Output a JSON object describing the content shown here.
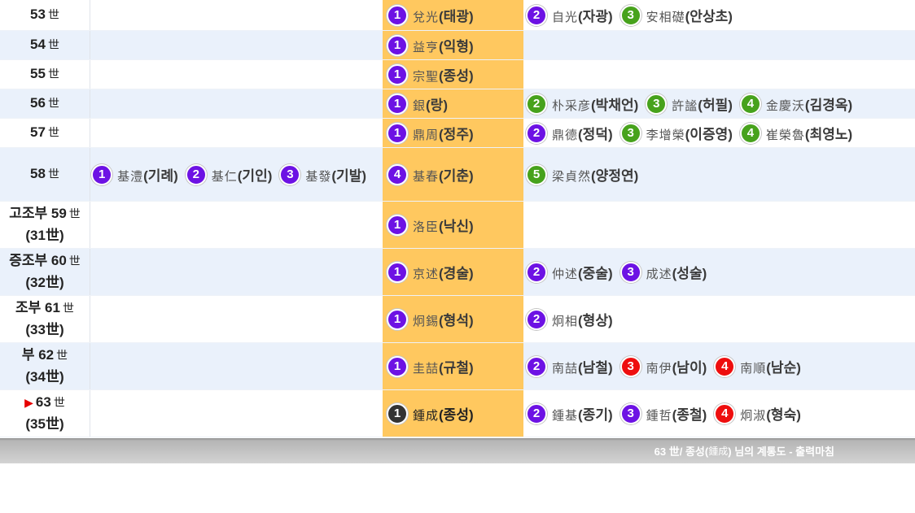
{
  "generations": [
    {
      "label": "53",
      "suffix": "世",
      "alt": false,
      "left": [],
      "center": [
        {
          "num": "1",
          "hanja": "兌光",
          "hangul": "(태광)",
          "color": "purple"
        }
      ],
      "right": [
        {
          "num": "2",
          "hanja": "自光",
          "hangul": "(자광)",
          "color": "purple"
        },
        {
          "num": "3",
          "hanja": "安相礎",
          "hangul": "(안상초)",
          "color": "green"
        }
      ]
    },
    {
      "label": "54",
      "suffix": "世",
      "alt": true,
      "left": [],
      "center": [
        {
          "num": "1",
          "hanja": "益亨",
          "hangul": "(익형)",
          "color": "purple"
        }
      ],
      "right": []
    },
    {
      "label": "55",
      "suffix": "世",
      "alt": false,
      "left": [],
      "center": [
        {
          "num": "1",
          "hanja": "宗聖",
          "hangul": "(종성)",
          "color": "purple"
        }
      ],
      "right": []
    },
    {
      "label": "56",
      "suffix": "世",
      "alt": true,
      "left": [],
      "center": [
        {
          "num": "1",
          "hanja": "銀",
          "hangul": "(랑)",
          "color": "purple"
        }
      ],
      "right": [
        {
          "num": "2",
          "hanja": "朴采彦",
          "hangul": "(박채언)",
          "color": "green"
        },
        {
          "num": "3",
          "hanja": "許謐",
          "hangul": "(허필)",
          "color": "green"
        },
        {
          "num": "4",
          "hanja": "金慶沃",
          "hangul": "(김경옥)",
          "color": "green"
        }
      ]
    },
    {
      "label": "57",
      "suffix": "世",
      "alt": false,
      "left": [],
      "center": [
        {
          "num": "1",
          "hanja": "鼎周",
          "hangul": "(정주)",
          "color": "purple"
        }
      ],
      "right": [
        {
          "num": "2",
          "hanja": "鼎德",
          "hangul": "(정덕)",
          "color": "purple"
        },
        {
          "num": "3",
          "hanja": "李增榮",
          "hangul": "(이증영)",
          "color": "green"
        },
        {
          "num": "4",
          "hanja": "崔榮魯",
          "hangul": "(최영노)",
          "color": "green"
        }
      ]
    },
    {
      "label": "58",
      "suffix": "世",
      "alt": true,
      "left": [
        {
          "num": "1",
          "hanja": "基澧",
          "hangul": "(기례)",
          "color": "purple"
        },
        {
          "num": "2",
          "hanja": "基仁",
          "hangul": "(기인)",
          "color": "purple"
        },
        {
          "num": "3",
          "hanja": "基發",
          "hangul": "(기발)",
          "color": "purple"
        }
      ],
      "center": [
        {
          "num": "4",
          "hanja": "基春",
          "hangul": "(기춘)",
          "color": "purple"
        }
      ],
      "right": [
        {
          "num": "5",
          "hanja": "梁貞然",
          "hangul": "(양정연)",
          "color": "green"
        }
      ]
    },
    {
      "prefix": "고조부",
      "label": "59",
      "suffix": "世",
      "sub": "(31世)",
      "alt": false,
      "left": [],
      "center": [
        {
          "num": "1",
          "hanja": "洛臣",
          "hangul": "(낙신)",
          "color": "purple"
        }
      ],
      "right": []
    },
    {
      "prefix": "증조부",
      "label": "60",
      "suffix": "世",
      "sub": "(32世)",
      "alt": true,
      "left": [],
      "center": [
        {
          "num": "1",
          "hanja": "京述",
          "hangul": "(경술)",
          "color": "purple"
        }
      ],
      "right": [
        {
          "num": "2",
          "hanja": "仲述",
          "hangul": "(중술)",
          "color": "purple"
        },
        {
          "num": "3",
          "hanja": "成述",
          "hangul": "(성술)",
          "color": "purple"
        }
      ]
    },
    {
      "prefix": "조부",
      "label": "61",
      "suffix": "世",
      "sub": "(33世)",
      "alt": false,
      "left": [],
      "center": [
        {
          "num": "1",
          "hanja": "炯錫",
          "hangul": "(형석)",
          "color": "purple"
        }
      ],
      "right": [
        {
          "num": "2",
          "hanja": "炯相",
          "hangul": "(형상)",
          "color": "purple"
        }
      ]
    },
    {
      "prefix": "부",
      "label": "62",
      "suffix": "世",
      "sub": "(34世)",
      "alt": true,
      "left": [],
      "center": [
        {
          "num": "1",
          "hanja": "圭喆",
          "hangul": "(규철)",
          "color": "purple"
        }
      ],
      "right": [
        {
          "num": "2",
          "hanja": "南喆",
          "hangul": "(남철)",
          "color": "purple"
        },
        {
          "num": "3",
          "hanja": "南伊",
          "hangul": "(남이)",
          "color": "red"
        },
        {
          "num": "4",
          "hanja": "南順",
          "hangul": "(남순)",
          "color": "red"
        }
      ]
    },
    {
      "marker": "▶",
      "label": "63",
      "suffix": "世",
      "sub": "(35世)",
      "alt": false,
      "left": [],
      "center": [
        {
          "num": "1",
          "hanja": "鍾成",
          "hangul": "(종성)",
          "color": "dark",
          "current": true
        }
      ],
      "right": [
        {
          "num": "2",
          "hanja": "鍾基",
          "hangul": "(종기)",
          "color": "purple"
        },
        {
          "num": "3",
          "hanja": "鍾哲",
          "hangul": "(종철)",
          "color": "purple"
        },
        {
          "num": "4",
          "hanja": "炯淑",
          "hangul": "(형숙)",
          "color": "red"
        }
      ]
    }
  ],
  "footer": {
    "gen": "63 世",
    "sep": " / 종성(",
    "hanja": "鍾成",
    "rest": ") 님의 계통도 - 출력마침"
  },
  "colors": {
    "center_column": "#ffc85f",
    "alt_row": "#eaf1fb",
    "badge_purple": "#6d12e4",
    "badge_green": "#47a21c",
    "badge_red": "#ee0e0e",
    "badge_dark": "#333333"
  }
}
